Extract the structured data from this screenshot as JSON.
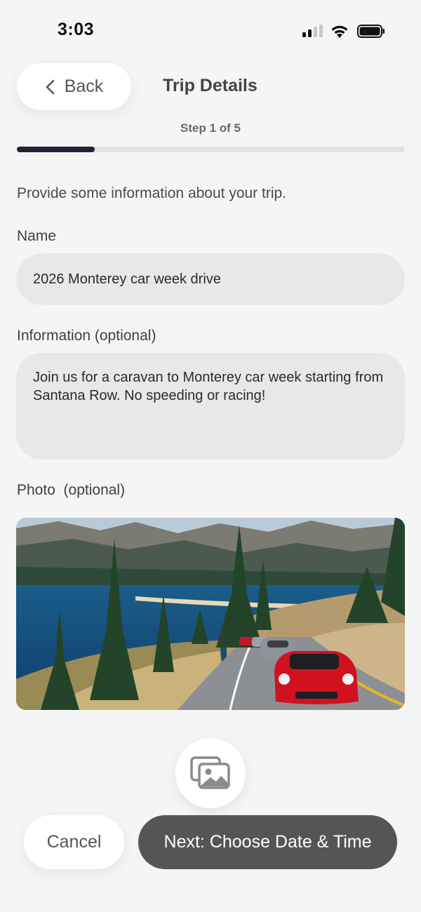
{
  "status_bar": {
    "time": "3:03"
  },
  "header": {
    "back_label": "Back",
    "title": "Trip Details"
  },
  "progress": {
    "step_text": "Step 1 of 5",
    "fraction": 0.2
  },
  "form": {
    "intro": "Provide some information about your trip.",
    "name_label": "Name",
    "name_value": "2026 Monterey car week drive",
    "info_label": "Information (optional)",
    "info_value": "Join us for a caravan to Monterey car week starting from Santana Row. No speeding or racing!",
    "photo_label": "Photo  (optional)"
  },
  "icons": {
    "photo_picker": "photo-gallery-icon"
  },
  "footer": {
    "cancel_label": "Cancel",
    "next_label": "Next: Choose Date & Time"
  },
  "colors": {
    "background": "#f5f5f5",
    "progress": "#1f2532",
    "primary_button": "#555555",
    "input": "#e8e8e8"
  }
}
